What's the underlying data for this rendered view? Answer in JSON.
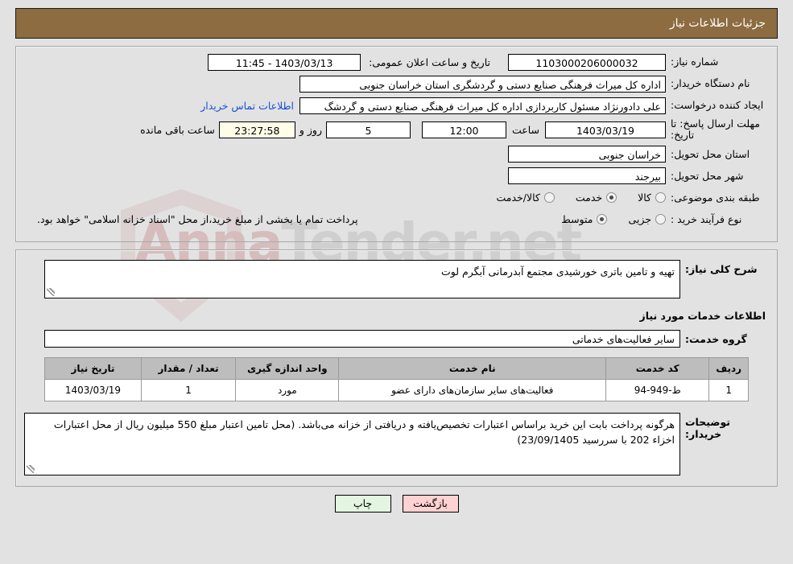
{
  "header": {
    "title": "جزئیات اطلاعات نیاز",
    "bar_color": "#8c6c40"
  },
  "watermark": {
    "text_left": "Anna",
    "text_right": "Tender.net",
    "shield_icon": "shield-watermark"
  },
  "top_panel": {
    "need_number": {
      "label": "شماره نیاز:",
      "value": "1103000206000032"
    },
    "announce_datetime": {
      "label": "تاریخ و ساعت اعلان عمومی:",
      "value": "1403/03/13 - 11:45"
    },
    "buyer_org": {
      "label": "نام دستگاه خریدار:",
      "value": "اداره کل میراث فرهنگی  صنایع دستی و گردشگری استان خراسان جنوبی"
    },
    "requester": {
      "label": "ایجاد کننده درخواست:",
      "value": "علی دادورنژاد مسئول کاربردازی اداره کل میراث فرهنگی  صنایع دستی و گردشگ"
    },
    "contact_link": "اطلاعات تماس خریدار",
    "deadline": {
      "label": "مهلت ارسال پاسخ: تا تاریخ:",
      "date": "1403/03/19",
      "hour_label": "ساعت",
      "hour": "12:00",
      "days": "5",
      "days_label": "روز و",
      "countdown": "23:27:58",
      "countdown_label": "ساعت باقی مانده"
    },
    "province": {
      "label": "استان محل تحویل:",
      "value": "خراسان جنوبی"
    },
    "city": {
      "label": "شهر محل تحویل:",
      "value": "بیرجند"
    },
    "category": {
      "label": "طبقه بندی موضوعی:",
      "options": [
        {
          "label": "کالا",
          "selected": false
        },
        {
          "label": "خدمت",
          "selected": true
        },
        {
          "label": "کالا/خدمت",
          "selected": false
        }
      ]
    },
    "process_type": {
      "label": "نوع فرآیند خرید :",
      "options": [
        {
          "label": "جزیی",
          "selected": false
        },
        {
          "label": "متوسط",
          "selected": true
        }
      ],
      "note": "پرداخت تمام یا بخشی از مبلغ خرید،از محل \"اسناد خزانه اسلامی\" خواهد بود."
    }
  },
  "bottom_panel": {
    "need_desc": {
      "label": "شرح کلی نیاز:",
      "value": "تهیه و تامین باتری خورشیدی مجتمع آبدرمانی آبگرم لوت"
    },
    "services_section_title": "اطلاعات خدمات مورد نیاز",
    "service_group": {
      "label": "گروه خدمت:",
      "value": "سایر فعالیت‌های خدماتی"
    },
    "items_table": {
      "columns": [
        "ردیف",
        "کد خدمت",
        "نام خدمت",
        "واحد اندازه گیری",
        "تعداد / مقدار",
        "تاریخ نیاز"
      ],
      "rows": [
        {
          "radif": "1",
          "code": "ط-949-94",
          "name": "فعالیت‌های سایر سازمان‌های دارای عضو",
          "unit": "مورد",
          "qty": "1",
          "date": "1403/03/19"
        }
      ]
    },
    "buyer_notes": {
      "label": "توضیحات خریدار:",
      "value": "هرگونه پرداخت بابت این خرید براساس اعتبارات تخصیص‌یافته و دریافتی از خزانه می‌باشد. (محل تامین اعتبار مبلغ 550 میلیون ریال از محل اعتبارات  اخزاء 202 با سررسید 23/09/1405)"
    }
  },
  "footer": {
    "print_label": "چاپ",
    "back_label": "بازگشت",
    "print_color": "#e4f5e1",
    "back_color": "#ffd2d2"
  }
}
